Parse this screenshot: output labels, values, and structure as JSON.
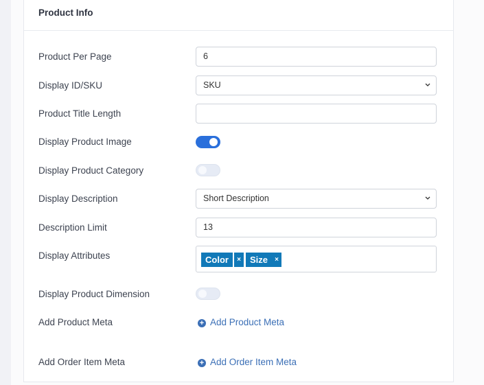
{
  "section": {
    "title": "Product Info"
  },
  "fields": {
    "product_per_page": {
      "label": "Product Per Page",
      "value": "6"
    },
    "display_id_sku": {
      "label": "Display ID/SKU",
      "value": "SKU"
    },
    "product_title_length": {
      "label": "Product Title Length",
      "value": ""
    },
    "display_product_image": {
      "label": "Display Product Image",
      "enabled": true
    },
    "display_product_category": {
      "label": "Display Product Category",
      "enabled": false
    },
    "display_description": {
      "label": "Display Description",
      "value": "Short Description"
    },
    "description_limit": {
      "label": "Description Limit",
      "value": "13"
    },
    "display_attributes": {
      "label": "Display Attributes",
      "tags": [
        {
          "label": "Color",
          "remove": "×"
        },
        {
          "label": "Size",
          "remove": "×"
        }
      ]
    },
    "display_product_dimension": {
      "label": "Display Product Dimension",
      "enabled": false
    },
    "add_product_meta": {
      "label": "Add Product Meta",
      "link": "Add Product Meta"
    },
    "add_order_item_meta": {
      "label": "Add Order Item Meta",
      "link": "Add Order Item Meta"
    }
  },
  "colors": {
    "accent": "#2a6fdb",
    "tag": "#1179b8",
    "link": "#3b6fb6"
  },
  "icons": {
    "select": "chevron-down-icon",
    "add": "plus-circle-icon"
  }
}
